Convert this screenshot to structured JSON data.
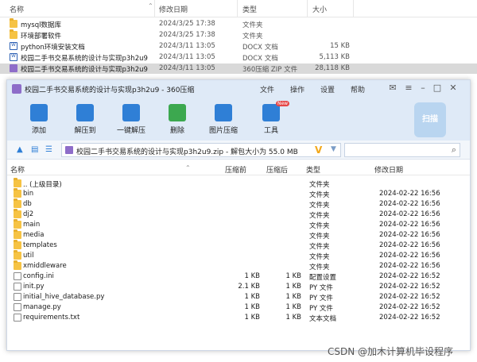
{
  "explorer": {
    "columns": {
      "name": "名称",
      "date": "修改日期",
      "type": "类型",
      "size": "大小"
    },
    "rows": [
      {
        "name": "mysql数据库",
        "date": "2024/3/25 17:38",
        "type": "文件夹",
        "size": "",
        "icon": "folder"
      },
      {
        "name": "环境部署软件",
        "date": "2024/3/25 17:38",
        "type": "文件夹",
        "size": "",
        "icon": "folder"
      },
      {
        "name": "python环境安装文档",
        "date": "2024/3/11 13:05",
        "type": "DOCX 文档",
        "size": "15 KB",
        "icon": "docx"
      },
      {
        "name": "校园二手书交易系统的设计与实现p3h2u9",
        "date": "2024/3/11 13:05",
        "type": "DOCX 文档",
        "size": "5,113 KB",
        "icon": "docx"
      },
      {
        "name": "校园二手书交易系统的设计与实现p3h2u9",
        "date": "2024/3/11 13:05",
        "type": "360压缩 ZIP 文件",
        "size": "28,118 KB",
        "icon": "zip"
      }
    ]
  },
  "window": {
    "title": "校园二手书交易系统的设计与实现p3h2u9 - 360压缩",
    "menus": [
      "文件",
      "操作",
      "设置",
      "帮助"
    ],
    "tools": [
      {
        "label": "添加",
        "icon": "add-icon"
      },
      {
        "label": "解压到",
        "icon": "extract-to-icon"
      },
      {
        "label": "一键解压",
        "icon": "one-click-extract-icon"
      },
      {
        "label": "删除",
        "icon": "delete-icon"
      },
      {
        "label": "图片压缩",
        "icon": "image-compress-icon"
      },
      {
        "label": "工具",
        "icon": "tools-icon",
        "badge": "New"
      }
    ],
    "scan_label": "扫描",
    "path": "校园二手书交易系统的设计与实现p3h2u9.zip - 解包大小为 55.0 MB",
    "search_placeholder": "",
    "list_columns": {
      "name": "名称",
      "packed": "压缩前",
      "unpacked": "压缩后",
      "type": "类型",
      "date": "修改日期"
    },
    "items": [
      {
        "name": ".. (上级目录)",
        "packed": "",
        "unpacked": "",
        "type": "文件夹",
        "date": "",
        "icon": "folder"
      },
      {
        "name": "bin",
        "packed": "",
        "unpacked": "",
        "type": "文件夹",
        "date": "2024-02-22 16:56",
        "icon": "folder"
      },
      {
        "name": "db",
        "packed": "",
        "unpacked": "",
        "type": "文件夹",
        "date": "2024-02-22 16:56",
        "icon": "folder"
      },
      {
        "name": "dj2",
        "packed": "",
        "unpacked": "",
        "type": "文件夹",
        "date": "2024-02-22 16:56",
        "icon": "folder"
      },
      {
        "name": "main",
        "packed": "",
        "unpacked": "",
        "type": "文件夹",
        "date": "2024-02-22 16:56",
        "icon": "folder"
      },
      {
        "name": "media",
        "packed": "",
        "unpacked": "",
        "type": "文件夹",
        "date": "2024-02-22 16:56",
        "icon": "folder"
      },
      {
        "name": "templates",
        "packed": "",
        "unpacked": "",
        "type": "文件夹",
        "date": "2024-02-22 16:56",
        "icon": "folder"
      },
      {
        "name": "util",
        "packed": "",
        "unpacked": "",
        "type": "文件夹",
        "date": "2024-02-22 16:56",
        "icon": "folder"
      },
      {
        "name": "xmiddleware",
        "packed": "",
        "unpacked": "",
        "type": "文件夹",
        "date": "2024-02-22 16:56",
        "icon": "folder"
      },
      {
        "name": "config.ini",
        "packed": "1 KB",
        "unpacked": "1 KB",
        "type": "配置设置",
        "date": "2024-02-22 16:52",
        "icon": "file"
      },
      {
        "name": "init.py",
        "packed": "2.1 KB",
        "unpacked": "1 KB",
        "type": "PY 文件",
        "date": "2024-02-22 16:52",
        "icon": "file"
      },
      {
        "name": "initial_hive_database.py",
        "packed": "1 KB",
        "unpacked": "1 KB",
        "type": "PY 文件",
        "date": "2024-02-22 16:52",
        "icon": "file"
      },
      {
        "name": "manage.py",
        "packed": "1 KB",
        "unpacked": "1 KB",
        "type": "PY 文件",
        "date": "2024-02-22 16:52",
        "icon": "file"
      },
      {
        "name": "requirements.txt",
        "packed": "1 KB",
        "unpacked": "1 KB",
        "type": "文本文档",
        "date": "2024-02-22 16:52",
        "icon": "file"
      }
    ]
  },
  "watermark": "CSDN @加木计算机毕设程序"
}
